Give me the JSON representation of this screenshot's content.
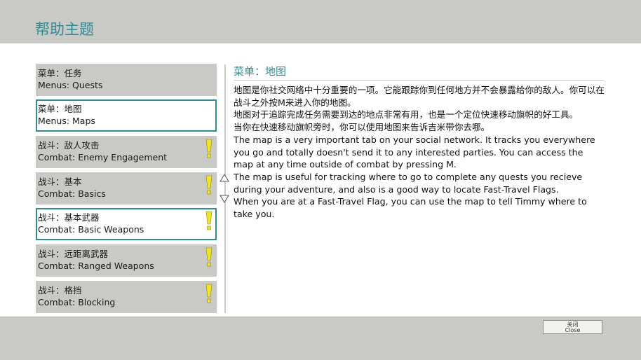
{
  "header": {
    "title": "帮助主题"
  },
  "topics": [
    {
      "zh": "菜单：任务",
      "en": "Menus: Quests",
      "alert": false,
      "selected": false
    },
    {
      "zh": "菜单：地图",
      "en": "Menus: Maps",
      "alert": false,
      "selected": true
    },
    {
      "zh": "战斗：敌人攻击",
      "en": "Combat: Enemy Engagement",
      "alert": true,
      "selected": false
    },
    {
      "zh": "战斗：基本",
      "en": "Combat: Basics",
      "alert": true,
      "selected": false
    },
    {
      "zh": "战斗：基本武器",
      "en": "Combat: Basic Weapons",
      "alert": true,
      "selected": true
    },
    {
      "zh": "战斗：远距离武器",
      "en": "Combat: Ranged Weapons",
      "alert": true,
      "selected": false
    },
    {
      "zh": "战斗：格挡",
      "en": "Combat: Blocking",
      "alert": true,
      "selected": false
    }
  ],
  "content": {
    "title": "菜单：地图",
    "paragraphs": [
      "地图是你社交网络中十分重要的一项。它能跟踪你到任何地方并不会暴露给你的敌人。你可以在战斗之外按M来进入你的地图。",
      "地图对于追踪完成任务需要到达的地点非常有用，也是一个定位快速移动旗帜的好工具。",
      "当你在快速移动旗帜旁时，你可以使用地图来告诉吉米带你去哪。",
      "The map is a very important tab on your social network. It tracks you everywhere you go and totally doesn't send it to any interested parties. You can access the map at any time outside of combat by pressing M.",
      "The map is useful for tracking where to go to complete any quests you recieve during your adventure, and also is a good way to locate Fast-Travel Flags.",
      "When you are at a Fast-Travel Flag, you can use the map to tell Timmy where to take you."
    ]
  },
  "footer": {
    "close_zh": "关闭",
    "close_en": "Close"
  },
  "colors": {
    "accent": "#2d8c96",
    "alert": "#f0e61e",
    "panel": "#c9cac5"
  },
  "icons": {
    "alert": "exclamation-icon",
    "scroll_up": "triangle-up-icon",
    "scroll_down": "triangle-down-icon"
  }
}
